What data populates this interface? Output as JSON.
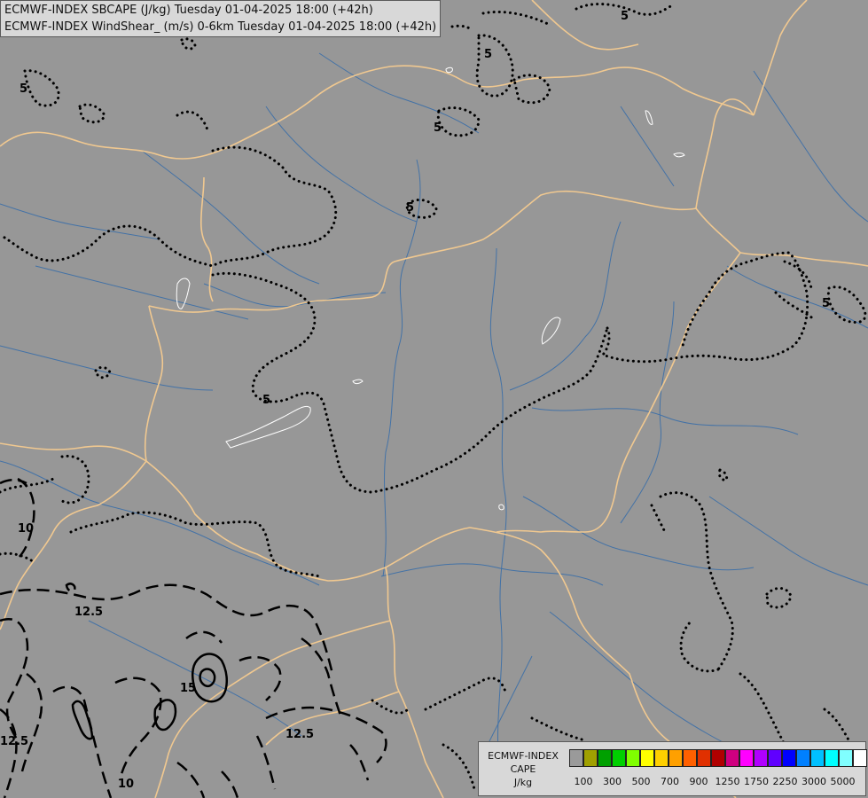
{
  "header": {
    "line1": "ECMWF-INDEX SBCAPE (J/kg) Tuesday 01-04-2025 18:00 (+42h)",
    "line2": "ECMWF-INDEX WindShear_ (m/s) 0-6km Tuesday 01-04-2025 18:00 (+42h)"
  },
  "legend": {
    "title_line1": "ECMWF-INDEX",
    "title_line2": "CAPE",
    "title_line3": "J/kg",
    "colors": [
      "#9a9a9a",
      "#a0a000",
      "#00a000",
      "#00d000",
      "#80ff00",
      "#ffff00",
      "#ffd000",
      "#ffa000",
      "#ff6000",
      "#e03000",
      "#b00000",
      "#d00080",
      "#ff00ff",
      "#b000ff",
      "#6000ff",
      "#0000ff",
      "#0080ff",
      "#00c0ff",
      "#00ffff",
      "#80ffff",
      "#ffffff"
    ],
    "tick_labels": [
      "100",
      "300",
      "500",
      "700",
      "900",
      "1250",
      "1750",
      "2250",
      "3000",
      "5000"
    ]
  },
  "contour_labels": {
    "shear_5": "5",
    "shear_10": "10",
    "shear_12_5": "12.5",
    "shear_15": "15"
  },
  "map_colors": {
    "background": "#979797",
    "border": "#f0c890",
    "river": "#3a6ea8",
    "lake": "#ffffff",
    "contour": "#000000"
  }
}
